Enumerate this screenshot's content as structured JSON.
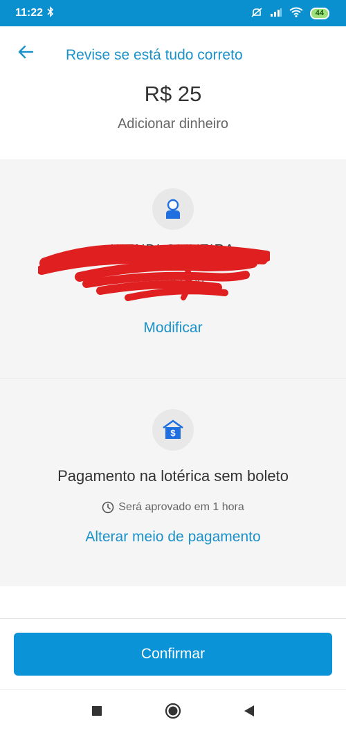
{
  "status_bar": {
    "time": "11:22",
    "battery": "44",
    "icons": [
      "bluetooth-icon",
      "mute-icon",
      "signal-icon",
      "wifi-icon",
      "battery-icon"
    ]
  },
  "header": {
    "title": "Revise se está tudo correto",
    "amount": "R$ 25",
    "subtitle": "Adicionar dinheiro"
  },
  "recipient": {
    "name": "WENDI OLIVEIRA",
    "document": "150.050 09",
    "modify_label": "Modificar"
  },
  "payment": {
    "method": "Pagamento na lotérica sem boleto",
    "approval_text": "Será aprovado em 1 hora",
    "change_label": "Alterar meio de pagamento"
  },
  "actions": {
    "confirm_label": "Confirmar"
  },
  "colors": {
    "status_bar": "#0a8fcf",
    "accent": "#1a91c9",
    "button": "#0a93d6",
    "section_bg": "#f5f5f5",
    "redaction": "#e02020"
  }
}
